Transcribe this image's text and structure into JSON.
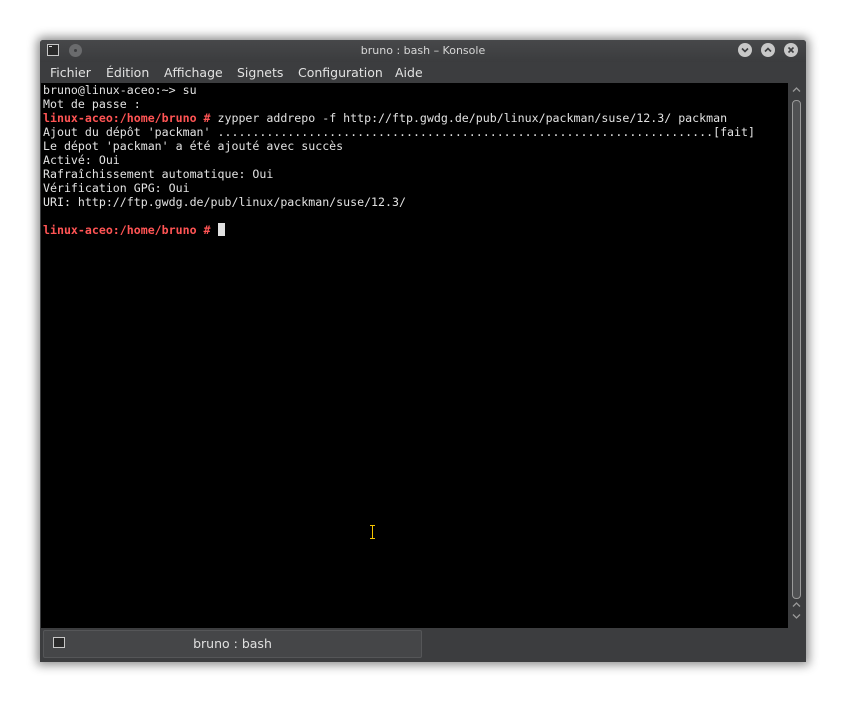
{
  "window": {
    "title": "bruno : bash – Konsole",
    "icon": "terminal-icon",
    "buttons": [
      "minimize-icon",
      "maximize-icon",
      "close-icon"
    ]
  },
  "menu": {
    "items": [
      {
        "label": "Fichier"
      },
      {
        "label": "Édition"
      },
      {
        "label": "Affichage"
      },
      {
        "label": "Signets"
      },
      {
        "label": "Configuration"
      },
      {
        "label": "Aide"
      }
    ]
  },
  "terminal": {
    "lines": [
      {
        "text": "bruno@linux-aceo:~> su"
      },
      {
        "text": "Mot de passe :"
      },
      {
        "prompt": "linux-aceo:/home/bruno #",
        "text": " zypper addrepo -f http://ftp.gwdg.de/pub/linux/packman/suse/12.3/ packman"
      },
      {
        "text": "Ajout du dépôt 'packman' .......................................................................[fait]"
      },
      {
        "text": "Le dépot 'packman' a été ajouté avec succès"
      },
      {
        "text": "Activé: Oui"
      },
      {
        "text": "Rafraîchissement automatique: Oui"
      },
      {
        "text": "Vérification GPG: Oui"
      },
      {
        "text": "URI: http://ftp.gwdg.de/pub/linux/packman/suse/12.3/"
      },
      {
        "text": ""
      },
      {
        "prompt": "linux-aceo:/home/bruno #",
        "text": " "
      }
    ],
    "prompt_color": "#ff5454",
    "text_color": "#e2e2e2",
    "background": "#000000"
  },
  "tabs": {
    "items": [
      {
        "label": "bruno : bash"
      }
    ]
  }
}
